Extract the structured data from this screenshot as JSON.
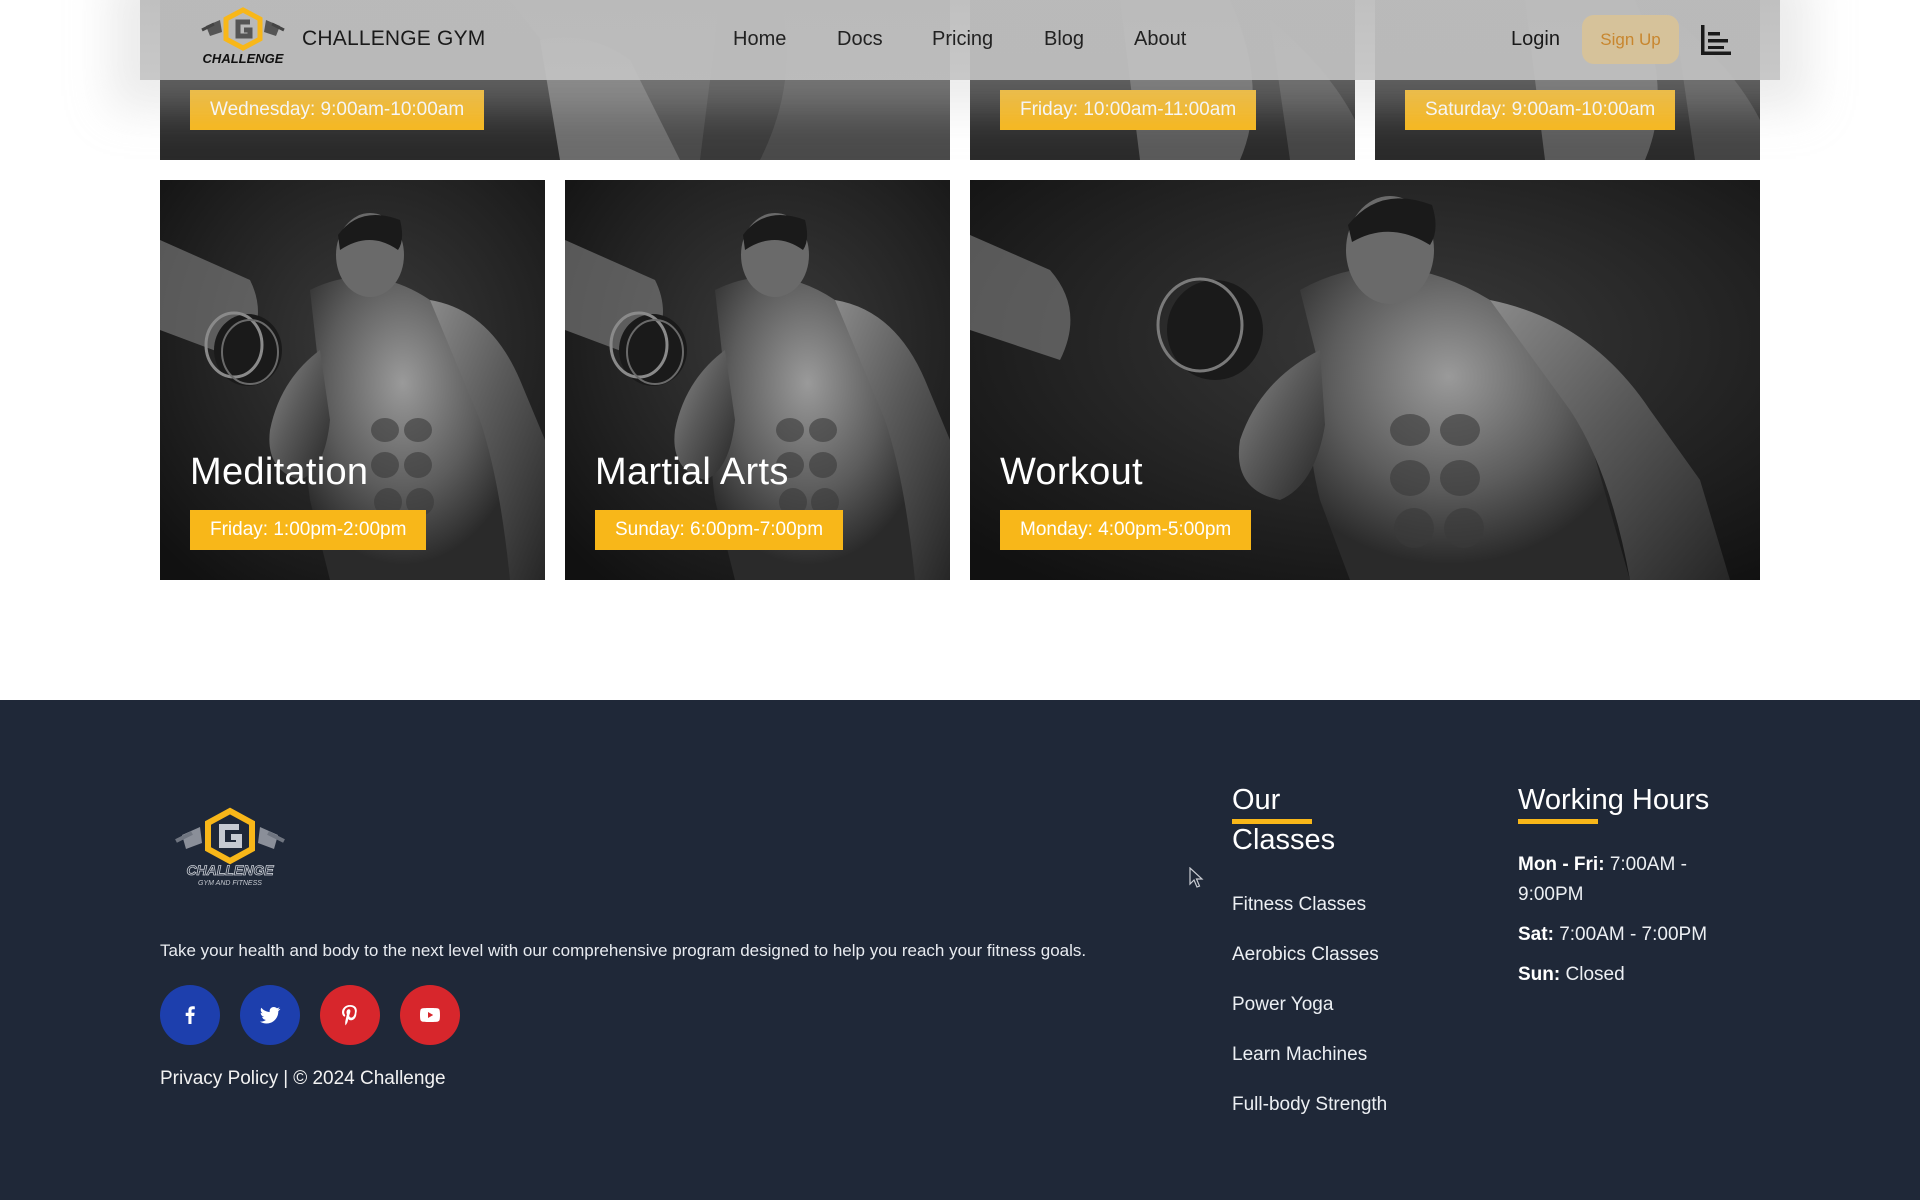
{
  "header": {
    "brand": "CHALLENGE GYM",
    "logo_text": "CHALLENGE",
    "nav": [
      "Home",
      "Docs",
      "Pricing",
      "Blog",
      "About"
    ],
    "login": "Login",
    "signup": "Sign Up"
  },
  "top_cards": [
    {
      "time": "Wednesday: 9:00am-10:00am"
    },
    {
      "time": "Friday: 10:00am-11:00am"
    },
    {
      "time": "Saturday: 9:00am-10:00am"
    }
  ],
  "cards": [
    {
      "title": "Meditation",
      "time": "Friday: 1:00pm-2:00pm"
    },
    {
      "title": "Martial Arts",
      "time": "Sunday: 6:00pm-7:00pm"
    },
    {
      "title": "Workout",
      "time": "Monday: 4:00pm-5:00pm"
    }
  ],
  "footer": {
    "logo_text": "CHALLENGE",
    "logo_subtext": "GYM AND FITNESS",
    "tagline": "Take your health and body to the next level with our comprehensive program designed to help you reach your fitness goals.",
    "social": [
      "facebook",
      "twitter",
      "pinterest",
      "youtube"
    ],
    "privacy": "Privacy Policy",
    "separator": "|",
    "copyright": "© 2024 Challenge",
    "classes_title_line1": "Our",
    "classes_title_line2": "Classes",
    "classes": [
      "Fitness Classes",
      "Aerobics Classes",
      "Power Yoga",
      "Learn Machines",
      "Full-body Strength"
    ],
    "hours_title": "Working Hours",
    "hours": [
      {
        "days": "Mon - Fri:",
        "time": "7:00AM -",
        "time2": "9:00PM"
      },
      {
        "days": "Sat:",
        "time": "7:00AM - 7:00PM"
      },
      {
        "days": "Sun:",
        "time": "Closed"
      }
    ]
  },
  "colors": {
    "accent": "#f8b719",
    "footer_bg": "#1f2838",
    "facebook": "#1d3fad",
    "twitter": "#1d3fad",
    "pinterest": "#d7262c",
    "youtube": "#d7262c"
  }
}
